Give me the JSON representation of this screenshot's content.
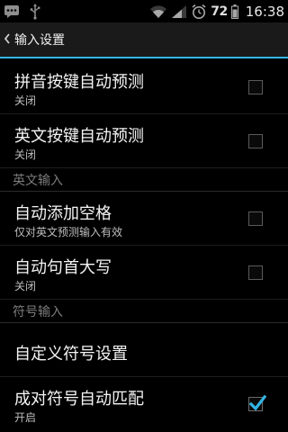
{
  "status_bar": {
    "icons_left": [
      "chat-icon",
      "usb-icon"
    ],
    "icons_right": [
      "wifi-icon",
      "signal-icon",
      "alarm-icon"
    ],
    "battery": "72",
    "time": "16:38"
  },
  "action_bar": {
    "back_icon": "chevron-left-icon",
    "title": "输入设置",
    "accent_color": "#33b5e5"
  },
  "settings": {
    "item1": {
      "title": "拼音按键自动预测",
      "summary": "关闭",
      "checked": false
    },
    "item2": {
      "title": "英文按键自动预测",
      "summary": "关闭",
      "checked": false
    },
    "section_en": "英文输入",
    "item3": {
      "title": "自动添加空格",
      "summary": "仅对英文预测输入有效",
      "checked": false
    },
    "item4": {
      "title": "自动句首大写",
      "summary": "关闭",
      "checked": false
    },
    "section_sym": "符号输入",
    "item5": {
      "title": "自定义符号设置"
    },
    "item6": {
      "title": "成对符号自动匹配",
      "summary": "开启",
      "checked": true
    }
  }
}
